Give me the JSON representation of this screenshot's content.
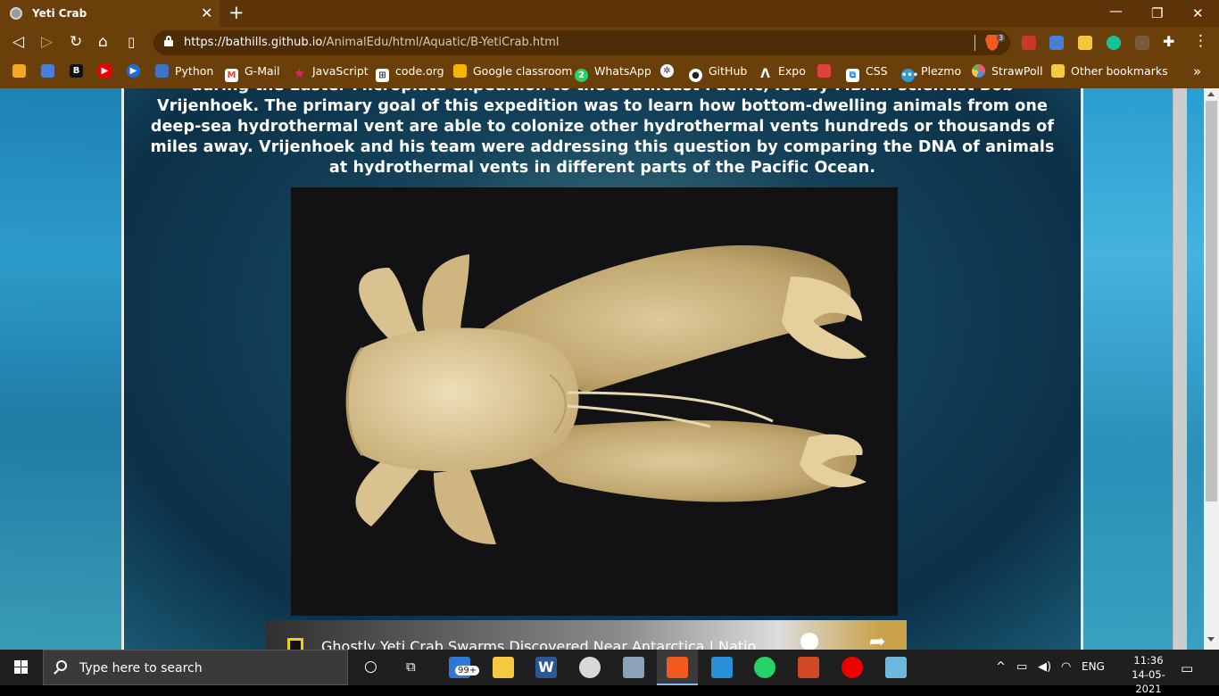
{
  "browser": {
    "tab_title": "Yeti Crab",
    "url_host": "https://bathills.github.io",
    "url_path": "/AnimalEdu/html/Aquatic/B-YetiCrab.html",
    "brave_badge": "3",
    "bookmarks": [
      {
        "label": "Python",
        "icon": "python-icon",
        "color": "#3b74c4"
      },
      {
        "label": "G-Mail",
        "icon": "gmail-icon",
        "color": "#e54435"
      },
      {
        "label": "JavaScript",
        "icon": "star-icon",
        "color": "#e0245e"
      },
      {
        "label": "code.org",
        "icon": "code-org-icon",
        "color": "#333333"
      },
      {
        "label": "Google classroom",
        "icon": "classroom-icon",
        "color": "#f4b400"
      },
      {
        "label": "WhatsApp",
        "icon": "whatsapp-icon",
        "color": "#25d366"
      },
      {
        "label": "",
        "icon": "openai-icon",
        "color": "#444444"
      },
      {
        "label": "GitHub",
        "icon": "github-icon",
        "color": "#222222"
      },
      {
        "label": "Expo",
        "icon": "expo-icon",
        "color": "#6b3f0a"
      },
      {
        "label": "",
        "icon": "calendar-icon",
        "color": "#e04040"
      },
      {
        "label": "CSS",
        "icon": "css-icon",
        "color": "#2a7ae2"
      },
      {
        "label": "Plezmo",
        "icon": "plezmo-icon",
        "color": "#2a9fd6"
      },
      {
        "label": "StrawPoll",
        "icon": "strawpoll-icon",
        "color": "#e85d75"
      },
      {
        "label": "Other bookmarks",
        "icon": "folder-icon",
        "color": "#f5c842"
      }
    ],
    "more_bookmarks": "»"
  },
  "page": {
    "paragraph": "during the Easter Microplate expedition to the southeast Pacific, led by MBARI scientist Bob Vrijenhoek. The primary goal of this expedition was to learn how bottom-dwelling animals from one deep-sea hydrothermal vent are able to colonize other hydrothermal vents hundreds or thousands of miles away. Vrijenhoek and his team were addressing this question by comparing the DNA of animals at hydrothermal vents in different parts of the Pacific Ocean.",
    "video_title": "Ghostly Yeti Crab Swarms Discovered Near Antarctica | Natio..."
  },
  "taskbar": {
    "search_placeholder": "Type here to search",
    "mail_badge": "99+",
    "language": "ENG",
    "time": "11:36",
    "date": "14-05-2021"
  },
  "colors": {
    "browser_frame": "#6b3f0a",
    "page_background": "#0f4a66",
    "photo_background": "#121114",
    "crab_fur": "#d6bf8a"
  }
}
